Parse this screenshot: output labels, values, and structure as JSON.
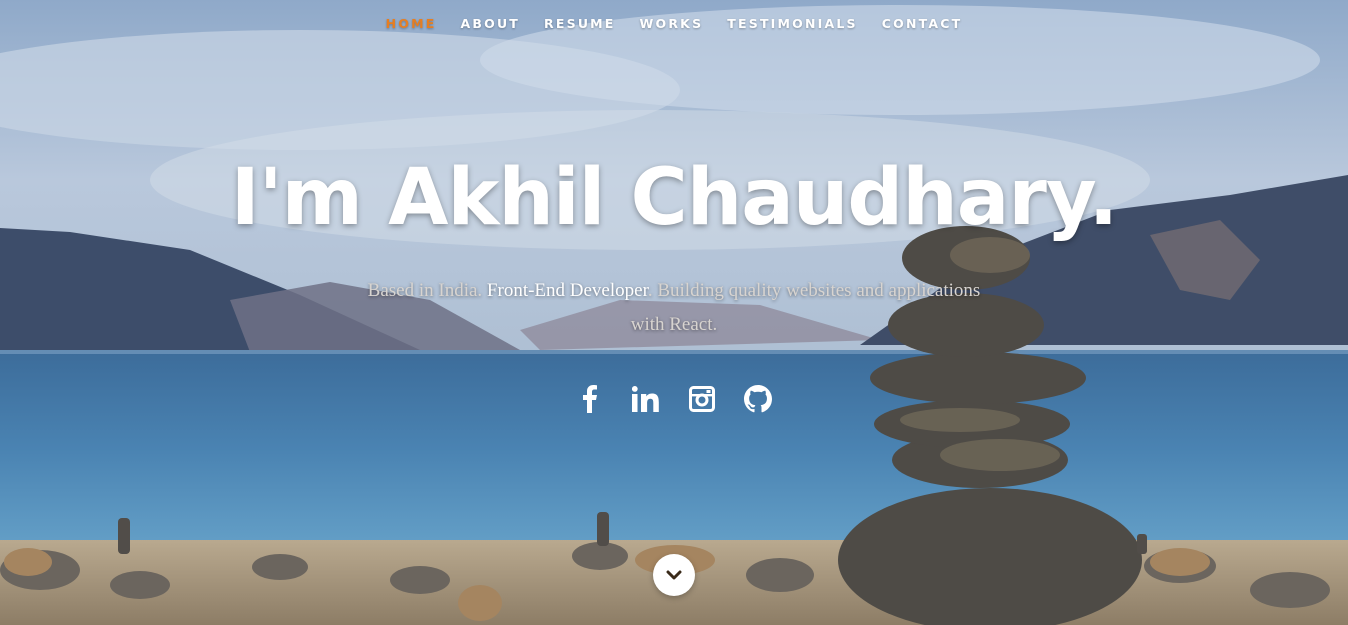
{
  "nav": {
    "items": [
      {
        "label": "HOME",
        "active": true
      },
      {
        "label": "ABOUT"
      },
      {
        "label": "RESUME"
      },
      {
        "label": "WORKS"
      },
      {
        "label": "TESTIMONIALS"
      },
      {
        "label": "CONTACT"
      }
    ]
  },
  "hero": {
    "headline": "I'm Akhil Chaudhary.",
    "tagline_part1": "Based in India. ",
    "tagline_highlight": "Front-End Developer",
    "tagline_part2": ". Building quality websites and applications with React."
  },
  "social": [
    "facebook-icon",
    "linkedin-icon",
    "instagram-icon",
    "github-icon"
  ],
  "colors": {
    "accent": "#e67e22",
    "text": "#ffffff"
  }
}
